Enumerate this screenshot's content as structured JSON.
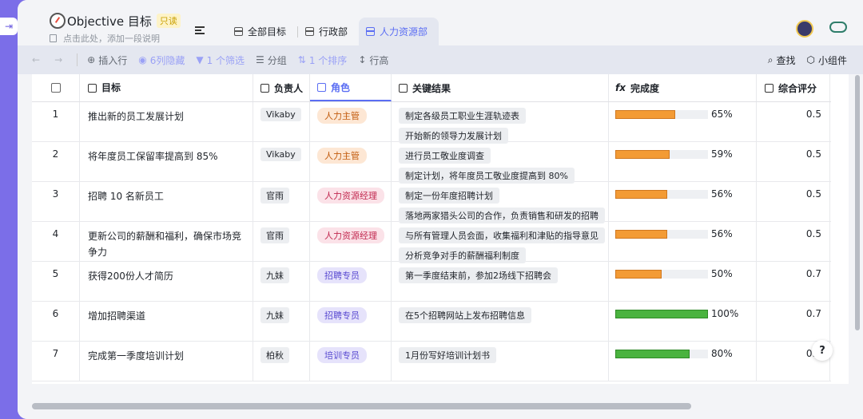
{
  "header": {
    "title": "Objective 目标",
    "readonly_badge": "只读",
    "description": "点击此处，添加一段说明"
  },
  "tabs": [
    {
      "label": "全部目标",
      "active": false
    },
    {
      "label": "行政部",
      "active": false
    },
    {
      "label": "人力资源部",
      "active": true
    }
  ],
  "toolbar": {
    "insert_row": "插入行",
    "hidden_cols": "6列隐藏",
    "filter": "1 个筛选",
    "group": "分组",
    "sort": "1 个排序",
    "row_height": "行高",
    "search": "查找",
    "widgets": "小组件"
  },
  "columns": {
    "goal": "目标",
    "owner": "负责人",
    "role": "角色",
    "key_results": "关键结果",
    "completion": "完成度",
    "score": "综合评分"
  },
  "rows": [
    {
      "idx": "1",
      "goal": "推出新的员工发展计划",
      "owner": "Vikaby",
      "role": "人力主管",
      "role_color": "orange",
      "krs": [
        "制定各级员工职业生涯轨迹表",
        "开始新的领导力发展计划"
      ],
      "pct": 65,
      "pct_label": "65%",
      "bar": "orange",
      "score": "0.5"
    },
    {
      "idx": "2",
      "goal": "将年度员工保留率提高到 85%",
      "owner": "Vikaby",
      "role": "人力主管",
      "role_color": "orange",
      "krs": [
        "进行员工敬业度调查",
        "制定计划，将年度员工敬业度提高到 80%"
      ],
      "pct": 59,
      "pct_label": "59%",
      "bar": "orange",
      "score": "0.5"
    },
    {
      "idx": "3",
      "goal": "招聘 10 名新员工",
      "owner": "官雨",
      "role": "人力资源经理",
      "role_color": "pink",
      "krs": [
        "制定一份年度招聘计划",
        "落地两家猎头公司的合作，负责销售和研发的招聘"
      ],
      "pct": 56,
      "pct_label": "56%",
      "bar": "orange",
      "score": "0.5"
    },
    {
      "idx": "4",
      "goal": "更新公司的薪酬和福利，确保市场竞争力",
      "owner": "官雨",
      "role": "人力资源经理",
      "role_color": "pink",
      "krs": [
        "与所有管理人员会面，收集福利和津贴的指导意见",
        "分析竞争对手的薪酬福利制度"
      ],
      "pct": 56,
      "pct_label": "56%",
      "bar": "orange",
      "score": "0.5"
    },
    {
      "idx": "5",
      "goal": "获得200份人才简历",
      "owner": "九妹",
      "role": "招聘专员",
      "role_color": "purple",
      "krs": [
        "第一季度结束前，参加2场线下招聘会"
      ],
      "pct": 50,
      "pct_label": "50%",
      "bar": "orange",
      "score": "0.7"
    },
    {
      "idx": "6",
      "goal": "增加招聘渠道",
      "owner": "九妹",
      "role": "招聘专员",
      "role_color": "purple",
      "krs": [
        "在5个招聘网站上发布招聘信息"
      ],
      "pct": 100,
      "pct_label": "100%",
      "bar": "green",
      "score": "0.7"
    },
    {
      "idx": "7",
      "goal": "完成第一季度培训计划",
      "owner": "柏秋",
      "role": "培训专员",
      "role_color": "purple",
      "krs": [
        "1月份写好培训计划书"
      ],
      "pct": 80,
      "pct_label": "80%",
      "bar": "green",
      "score": "0.7"
    }
  ],
  "help_label": "?"
}
